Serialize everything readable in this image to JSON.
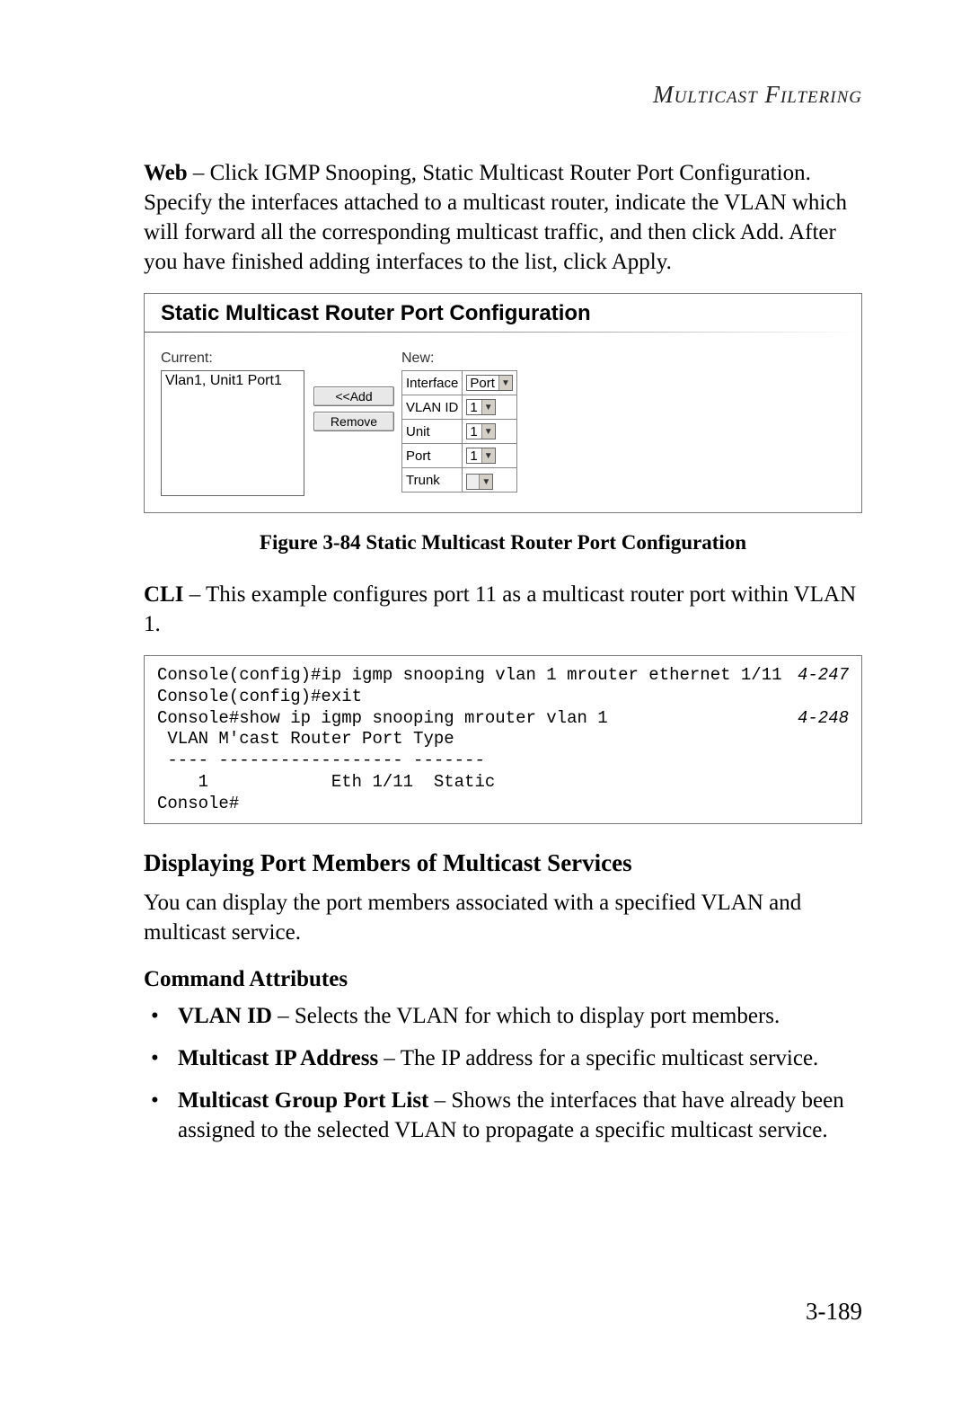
{
  "header": "Multicast Filtering",
  "para1_lead": "Web",
  "para1": " – Click IGMP Snooping, Static Multicast Router Port Configuration. Specify the interfaces attached to a multicast router, indicate the VLAN which will forward all the corresponding multicast traffic, and then click Add. After you have finished adding interfaces to the list, click Apply.",
  "panel": {
    "title": "Static Multicast Router Port Configuration",
    "current_label": "Current:",
    "current_value": "Vlan1, Unit1 Port1",
    "btn_add": "<<Add",
    "btn_remove": "Remove",
    "new_label": "New:",
    "rows": {
      "interface_label": "Interface",
      "interface_value": "Port",
      "vlan_label": "VLAN ID",
      "vlan_value": "1",
      "unit_label": "Unit",
      "unit_value": "1",
      "port_label": "Port",
      "port_value": "1",
      "trunk_label": "Trunk",
      "trunk_value": ""
    }
  },
  "figure_caption": "Figure 3-84  Static Multicast Router Port Configuration",
  "para2_lead": "CLI",
  "para2": " – This example configures port 11 as a multicast router port within VLAN 1.",
  "cli": {
    "line1": "Console(config)#ip igmp snooping vlan 1 mrouter ethernet 1/11",
    "ref1": "4-247",
    "line2": "Console(config)#exit",
    "line3": "Console#show ip igmp snooping mrouter vlan 1",
    "ref2": "4-248",
    "line4": " VLAN M'cast Router Port Type",
    "line5": " ---- ------------------ -------",
    "line6": "    1            Eth 1/11  Static",
    "line7": "Console#"
  },
  "h3": "Displaying Port Members of Multicast Services",
  "para3": "You can display the port members associated with a specified VLAN and multicast service.",
  "h4": "Command Attributes",
  "attrs": [
    {
      "term": "VLAN ID",
      "desc": " – Selects the VLAN for which to display port members."
    },
    {
      "term": "Multicast IP Address",
      "desc": " – The IP address for a specific multicast service."
    },
    {
      "term": "Multicast Group Port List",
      "desc": " – Shows the interfaces that have already been assigned to the selected VLAN to propagate a specific multicast service."
    }
  ],
  "page_number": "3-189"
}
